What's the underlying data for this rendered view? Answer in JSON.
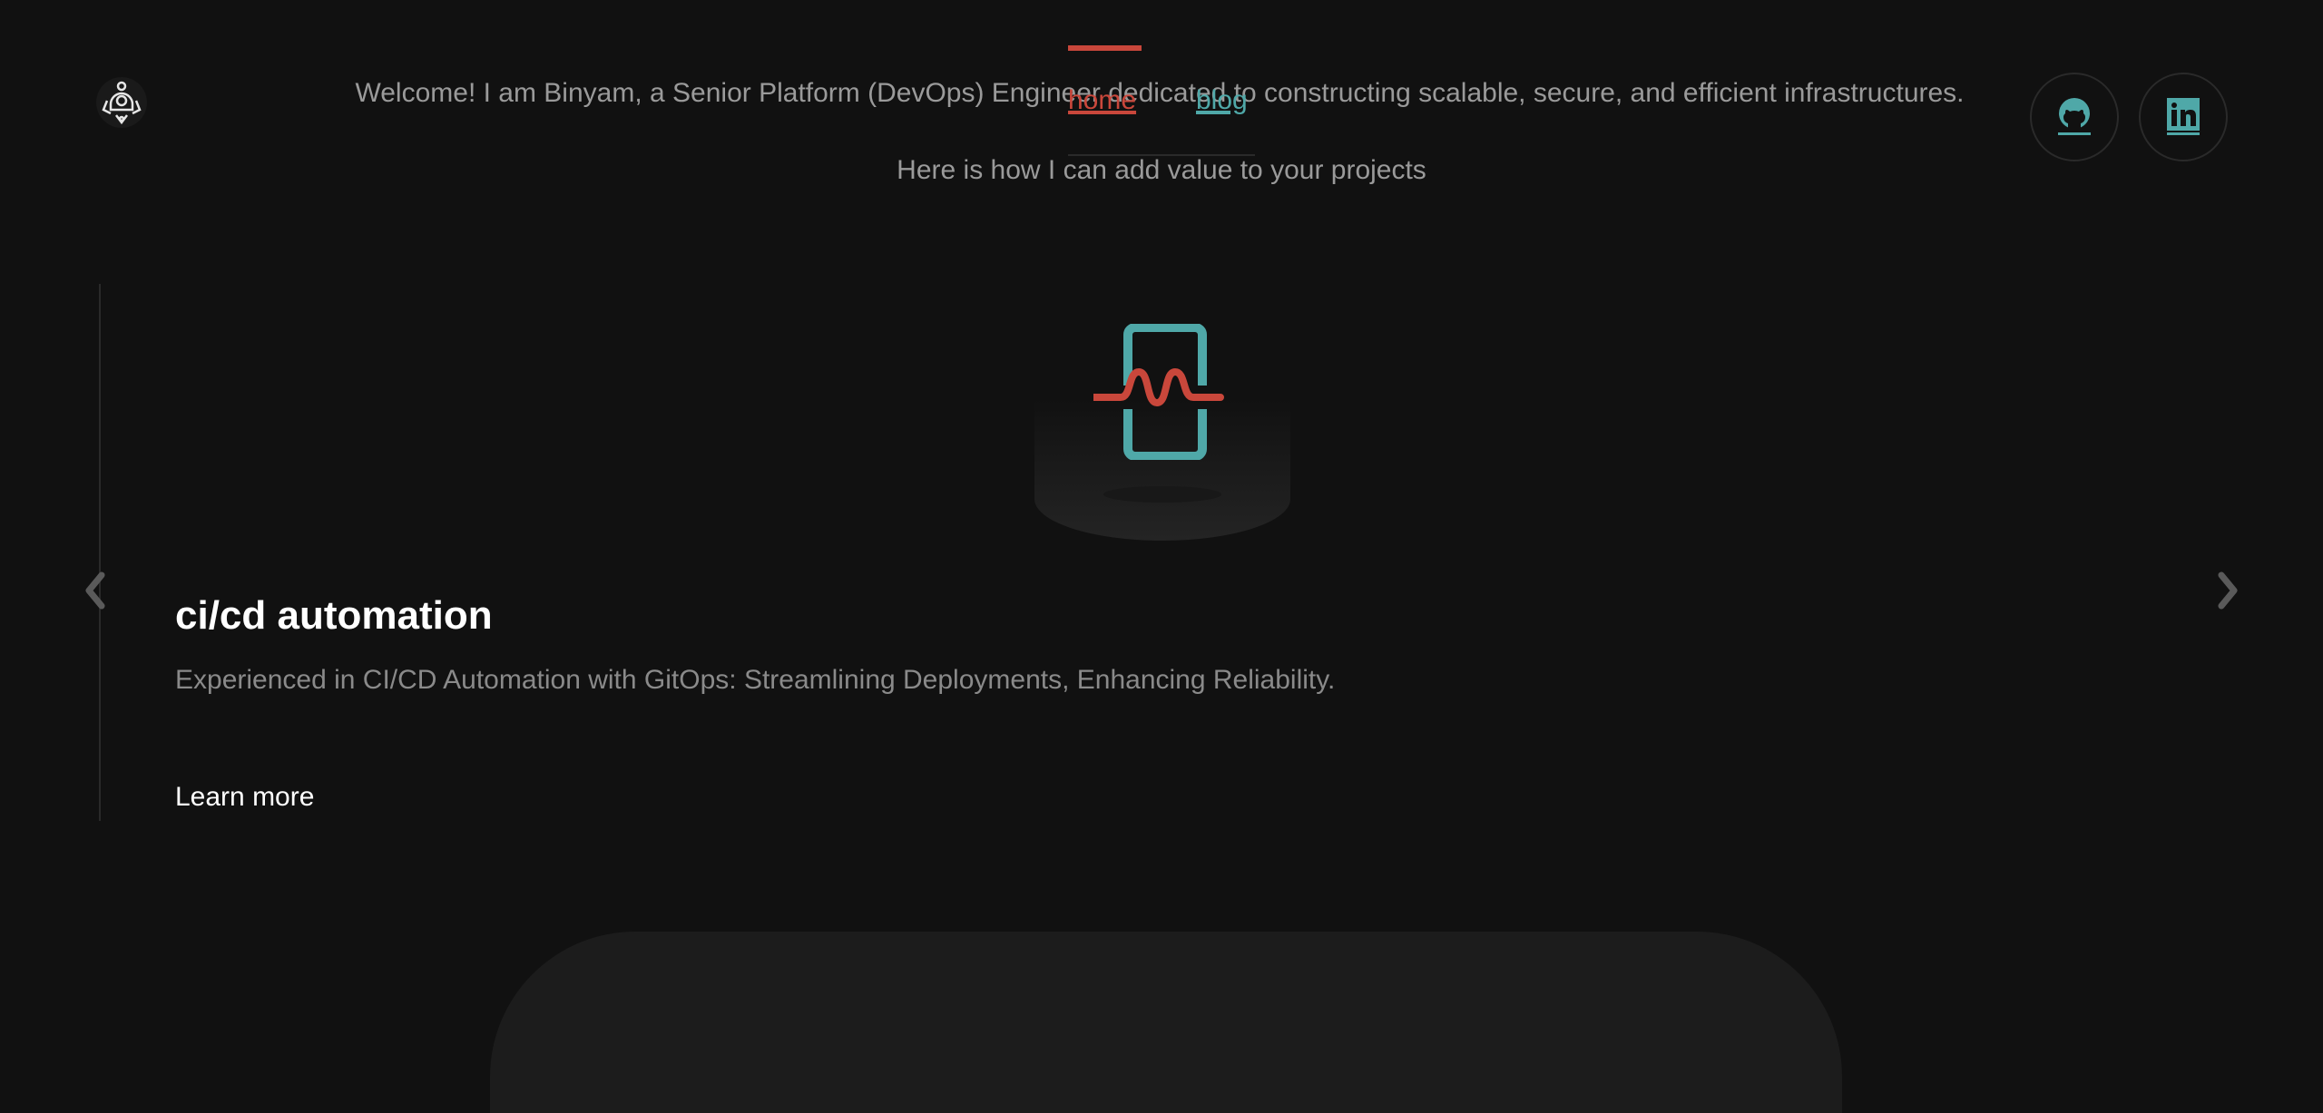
{
  "header": {
    "logo_name": "logo",
    "welcome": "Welcome! I am Binyam, a Senior Platform (DevOps) Engineer dedicated to constructing scalable, secure, and efficient infrastructures.",
    "subtitle": "Here is how I can add value to your projects"
  },
  "nav": {
    "items": [
      {
        "label": "home",
        "active": true
      },
      {
        "label": "blog",
        "active": false
      }
    ]
  },
  "social": [
    {
      "name": "github-icon"
    },
    {
      "name": "linkedin-icon"
    }
  ],
  "carousel": {
    "current": {
      "title": "ci/cd automation",
      "description": "Experienced in CI/CD Automation with GitOps: Streamlining Deployments, Enhancing Reliability.",
      "link": "Learn more"
    }
  },
  "colors": {
    "background": "#111111",
    "accent_red": "#c9473b",
    "accent_teal": "#4fa8a8",
    "muted_text": "#9a9a9a"
  }
}
